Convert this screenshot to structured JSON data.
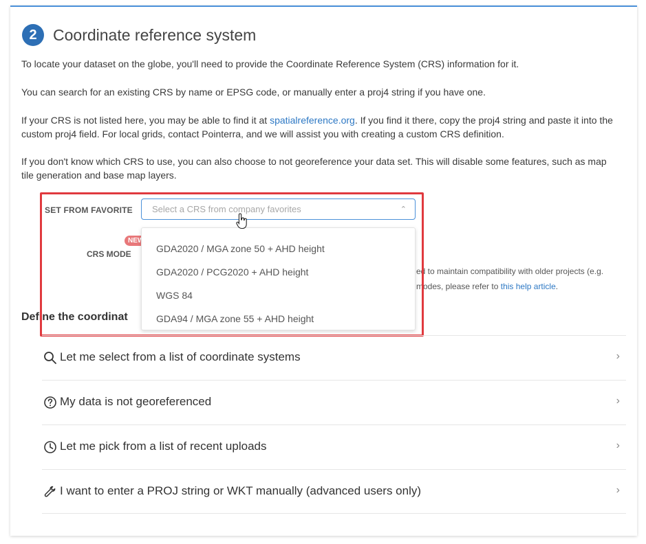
{
  "section": {
    "step_number": "2",
    "title": "Coordinate reference system"
  },
  "paragraphs": {
    "p1": "To locate your dataset on the globe, you'll need to provide the Coordinate Reference System (CRS) information for it.",
    "p2": "You can search for an existing CRS by name or EPSG code, or manually enter a proj4 string if you have one.",
    "p3_before": "If your CRS is not listed here, you may be able to find it at ",
    "p3_link": "spatialreference.org",
    "p3_after": ". If you find it there, copy the proj4 string and paste it into the custom proj4 field. For local grids, contact Pointerra, and we will assist you with creating a custom CRS definition.",
    "p4": "If you don't know which CRS to use, you can also choose to not georeference your data set. This will disable some features, such as map tile generation and base map layers."
  },
  "favorite": {
    "label": "SET FROM FAVORITE",
    "placeholder": "Select a CRS from company favorites",
    "options": [
      "GDA2020 / MGA zone 50 + AHD height",
      "GDA2020 / PCG2020 + AHD height",
      "WGS 84",
      "GDA94 / MGA zone 55 + AHD height"
    ]
  },
  "crs_mode": {
    "label": "CRS MODE",
    "badge": "NEW",
    "partial_line1": "ed to maintain compatibility with older projects (e.g.",
    "partial_line2_before": "modes, please refer to ",
    "partial_line2_link": "this help article",
    "partial_line2_after": "."
  },
  "define": {
    "heading_partial": "Define the coordinat"
  },
  "options": [
    {
      "label": "Let me select from a list of coordinate systems",
      "icon": "search-icon"
    },
    {
      "label": "My data is not georeferenced",
      "icon": "question-circle-icon"
    },
    {
      "label": "Let me pick from a list of recent uploads",
      "icon": "clock-icon"
    },
    {
      "label": "I want to enter a PROJ string or WKT manually (advanced users only)",
      "icon": "wrench-icon"
    }
  ],
  "colors": {
    "accent": "#2d6fb5",
    "link": "#2d78c4",
    "highlight_border": "#e0393e",
    "badge": "#e8787a"
  }
}
